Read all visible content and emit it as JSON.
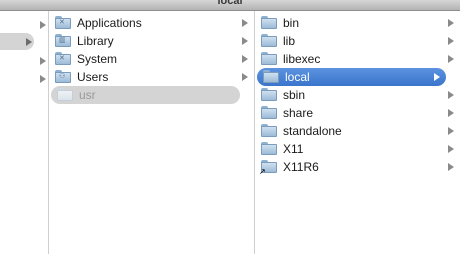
{
  "window": {
    "title": "local"
  },
  "column2": {
    "items": [
      {
        "label": "Applications",
        "icon": "applications-folder-icon"
      },
      {
        "label": "Library",
        "icon": "library-folder-icon"
      },
      {
        "label": "System",
        "icon": "system-folder-icon"
      },
      {
        "label": "Users",
        "icon": "users-folder-icon"
      },
      {
        "label": "usr",
        "icon": "folder-icon"
      }
    ]
  },
  "column3": {
    "items": [
      {
        "label": "bin"
      },
      {
        "label": "lib"
      },
      {
        "label": "libexec"
      },
      {
        "label": "local"
      },
      {
        "label": "sbin"
      },
      {
        "label": "share"
      },
      {
        "label": "standalone"
      },
      {
        "label": "X11"
      },
      {
        "label": "X11R6"
      }
    ]
  },
  "colors": {
    "selection_active": "#3a75cc",
    "selection_inactive": "#d4d4d4"
  }
}
